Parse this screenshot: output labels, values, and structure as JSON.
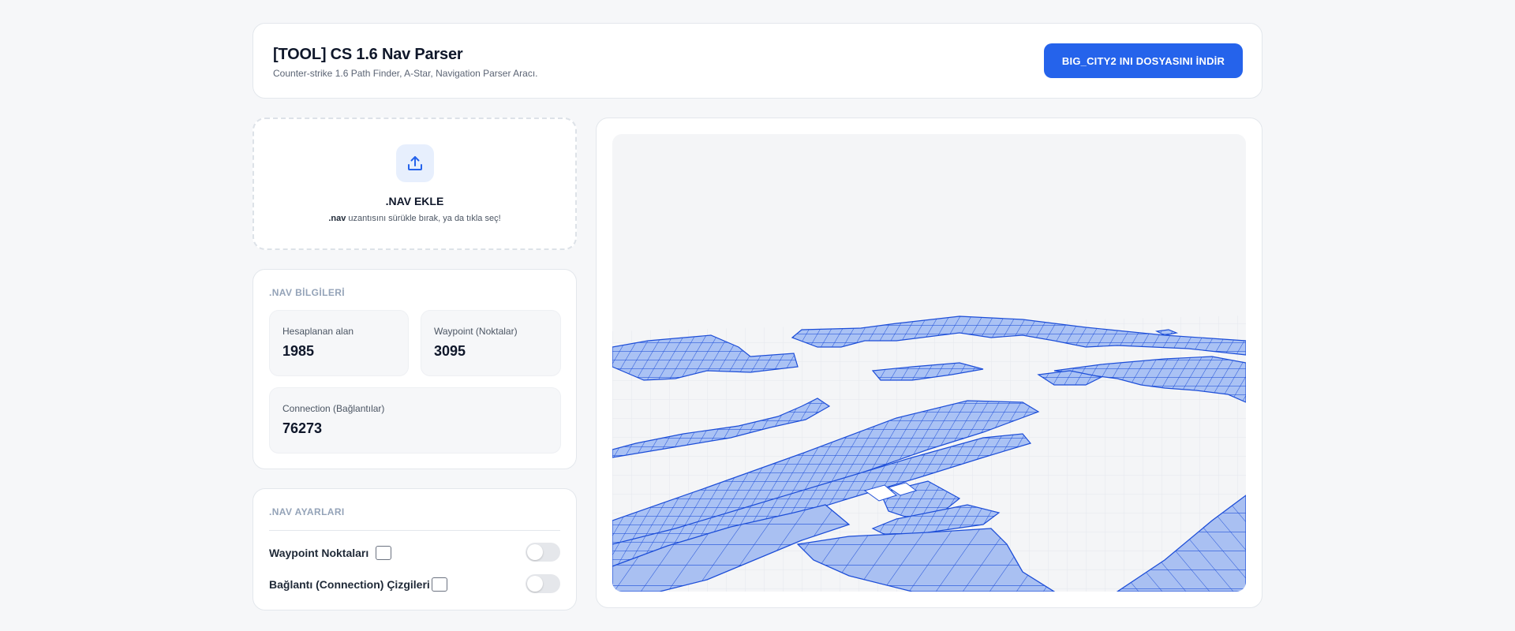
{
  "header": {
    "title": "[TOOL] CS 1.6 Nav Parser",
    "subtitle": "Counter-strike 1.6 Path Finder, A-Star, Navigation Parser Aracı.",
    "download_label": "BIG_CITY2 INI DOSYASINI İNDİR"
  },
  "upload": {
    "icon": "upload-icon",
    "title": ".NAV EKLE",
    "hint_ext": ".nav",
    "hint_rest": " uzantısını sürükle bırak, ya da tıkla seç!"
  },
  "info": {
    "title": ".NAV BİLGİLERİ",
    "stats": [
      {
        "label": "Hesaplanan alan",
        "value": "1985"
      },
      {
        "label": "Waypoint (Noktalar)",
        "value": "3095"
      },
      {
        "label": "Connection (Bağlantılar)",
        "value": "76273"
      }
    ]
  },
  "settings": {
    "title": ".NAV AYARLARI",
    "rows": [
      {
        "label": "Waypoint Noktaları",
        "checked": false,
        "toggle_on": false
      },
      {
        "label": "Bağlantı (Connection) Çizgileri",
        "checked": false,
        "toggle_on": false
      }
    ]
  },
  "colors": {
    "accent": "#2563eb",
    "mesh_fill": "#a9c1f3",
    "mesh_stroke": "#1d4ed8",
    "grid": "#dde1e6"
  }
}
